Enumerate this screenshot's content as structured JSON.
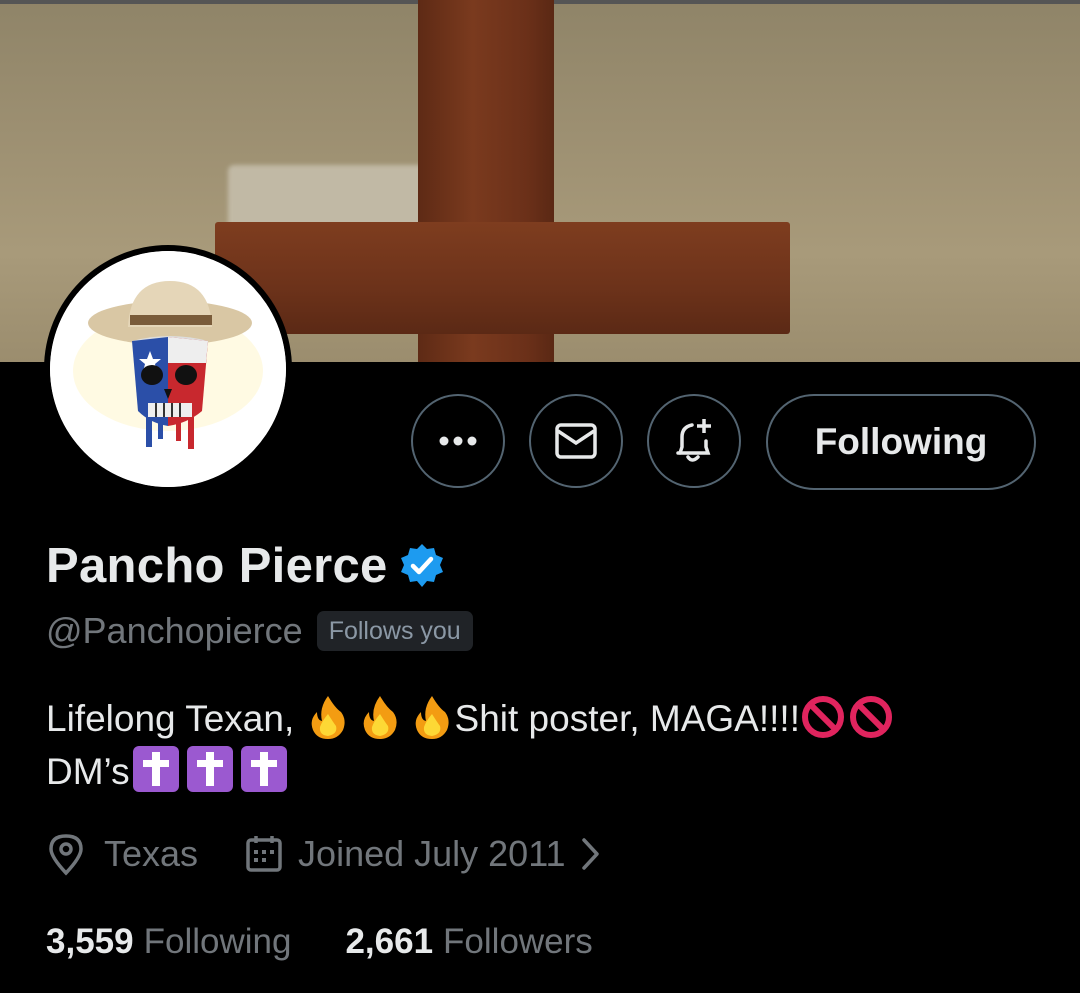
{
  "profile": {
    "display_name": "Pancho Pierce",
    "handle": "@Panchopierce",
    "follows_you_badge": "Follows you",
    "bio_line1_start": "Lifelong Texan,",
    "bio_line1_mid": "Shit poster, MAGA!!!!",
    "bio_line2_start": "DM’s",
    "location": "Texas",
    "joined": "Joined July 2011"
  },
  "actions": {
    "following_label": "Following"
  },
  "stats": {
    "following_count": "3,559",
    "following_label": "Following",
    "followers_count": "2,661",
    "followers_label": "Followers"
  },
  "icons": [
    "more-icon",
    "mail-icon",
    "bell-plus-icon",
    "verified-badge-icon",
    "fire-emoji",
    "prohibited-emoji",
    "latin-cross-emoji",
    "location-pin-icon",
    "calendar-icon",
    "chevron-right-icon"
  ],
  "colors": {
    "background": "#000000",
    "text_primary": "#e7e9ea",
    "text_secondary": "#71767b",
    "verified_blue": "#1d9bf0",
    "button_border": "#536471",
    "cross_emoji_purple": "#9b59d0",
    "prohibited_red": "#e0245e"
  }
}
